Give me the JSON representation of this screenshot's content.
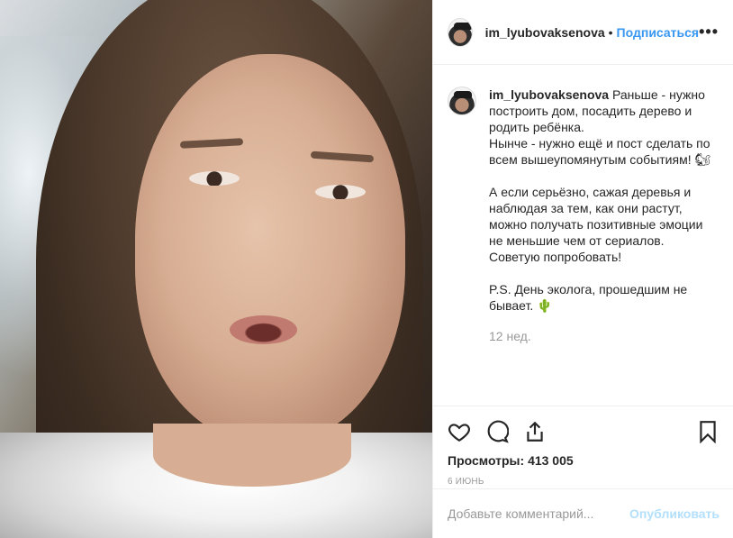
{
  "header": {
    "username": "im_lyubovaksenova",
    "separator": "•",
    "follow_label": "Подписаться",
    "more_label": "•••"
  },
  "caption": {
    "username": "im_lyubovaksenova",
    "para1": "Раньше - нужно построить дом, посадить дерево и родить ребёнка.\nНынче - нужно ещё и пост сделать по всем вышеупомянутым событиям! 🐿",
    "para2": "А если серьёзно, сажая деревья и наблюдая за тем, как они растут, можно получать позитивные эмоции не меньшие чем от сериалов. Советую попробовать!",
    "para3": "P.S. День эколога, прошедшим не бывает. 🌵",
    "time_ago": "12 нед."
  },
  "load_more_label": "+",
  "actions": {
    "like_icon": "heart-icon",
    "comment_icon": "comment-icon",
    "share_icon": "share-icon",
    "save_icon": "bookmark-icon"
  },
  "stats": {
    "views_label": "Просмотры:",
    "views_value": "413 005",
    "date": "6 ИЮНЬ"
  },
  "comment_box": {
    "placeholder": "Добавьте комментарий...",
    "post_label": "Опубликовать"
  },
  "colors": {
    "accent": "#3897f0",
    "post_disabled": "#b2dffc",
    "muted": "#999999"
  }
}
